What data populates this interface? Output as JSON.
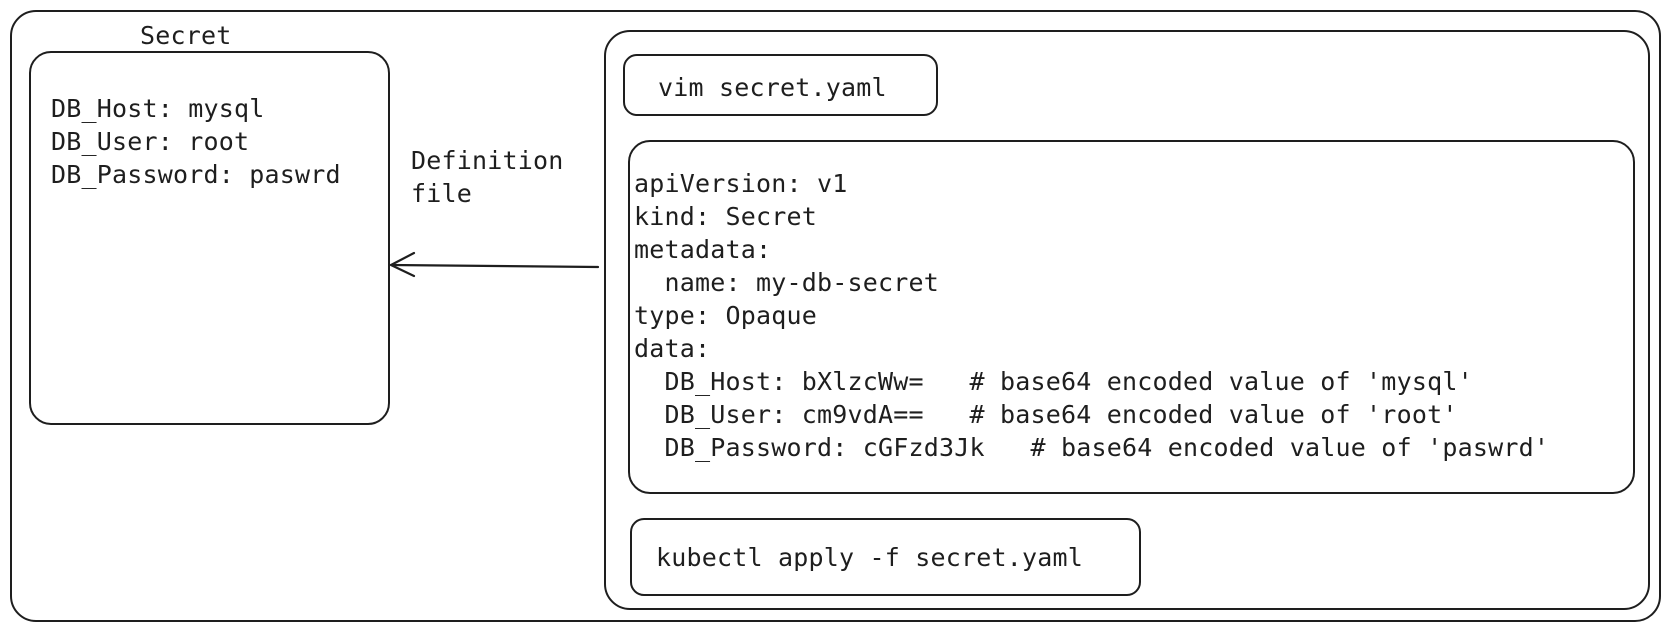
{
  "secret": {
    "title": "Secret",
    "lines": "DB_Host: mysql\nDB_User: root\nDB_Password: paswrd"
  },
  "arrow": {
    "label": "Definition\nfile"
  },
  "commands": {
    "create": "vim secret.yaml",
    "apply": "kubectl apply -f secret.yaml"
  },
  "definition_file": {
    "lines": "apiVersion: v1\nkind: Secret\nmetadata:\n  name: my-db-secret\ntype: Opaque\ndata:\n  DB_Host: bXlzcWw=   # base64 encoded value of 'mysql'\n  DB_User: cm9vdA==   # base64 encoded value of 'root'\n  DB_Password: cGFzd3Jk   # base64 encoded value of 'paswrd'"
  }
}
